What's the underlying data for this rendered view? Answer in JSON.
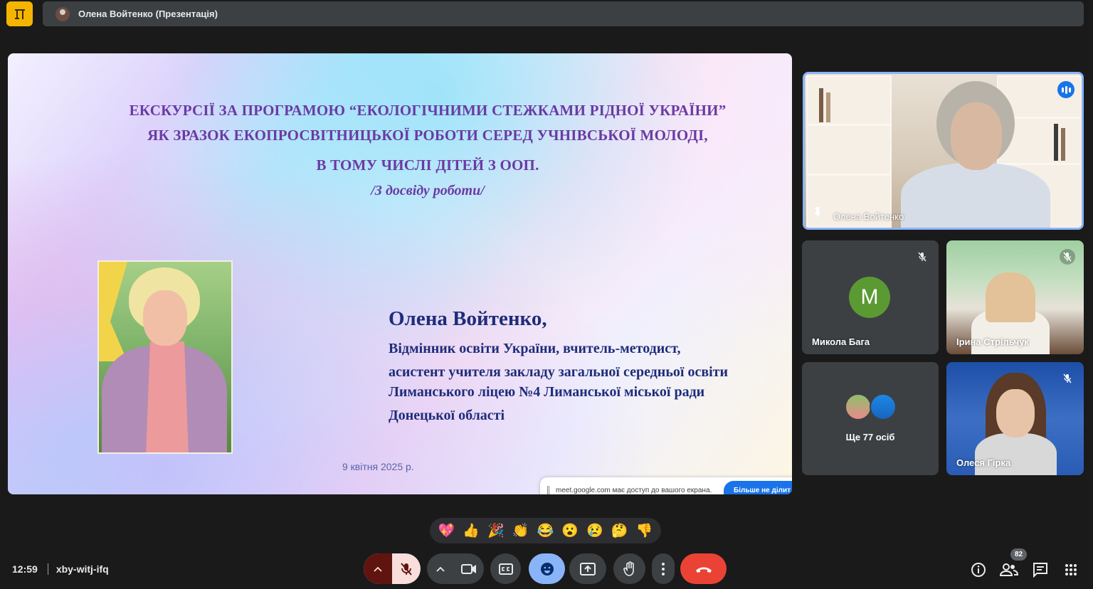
{
  "topbar": {
    "app_logo": "meet-logo",
    "presenting_title": "Олена Войтенко (Презентація)"
  },
  "slide": {
    "heading_lines": [
      "ЕКСКУРСІЇ ЗА ПРОГРАМОЮ “ЕКОЛОГІЧНИМИ СТЕЖКАМИ РІДНОЇ УКРАЇНИ”",
      "ЯК ЗРАЗОК ЕКОПРОСВІТНИЦЬКОЇ РОБОТИ СЕРЕД УЧНІВСЬКОЇ МОЛОДІ,",
      "В ТОМУ ЧИСЛІ ДІТЕЙ З ООП."
    ],
    "subtitle": "/З досвіду роботи/",
    "author_name": "Олена Войтенко,",
    "author_lines": [
      "Відмінник освіти України, вчитель-методист,",
      "асистент учителя закладу загальної середньої освіти",
      "Лиманського  ліцею №4  Лиманської  міської  ради",
      "Донецької області"
    ],
    "date": "9 квітня 2025 р."
  },
  "share_notice": {
    "text": "meet.google.com має доступ до вашого екрана.",
    "button": "Більше не ділит"
  },
  "participants": {
    "presenter": {
      "name": "Олена Войтенко"
    },
    "tiles": [
      {
        "name": "Микола Бага",
        "initial": "М",
        "avatar_color": "#5b9a32"
      },
      {
        "name": "Ірина Стрільчук"
      },
      {
        "name": "Ще 77 осіб"
      },
      {
        "name": "Олеся Гірка"
      }
    ]
  },
  "reactions": [
    "💖",
    "👍",
    "🎉",
    "👏",
    "😂",
    "😮",
    "😢",
    "🤔",
    "👎"
  ],
  "bottom": {
    "time": "12:59",
    "meeting_code": "xby-witj-ifq",
    "participant_count": "82"
  },
  "colors": {
    "accent": "#8ab4f8",
    "emoji_active": "#8ab4f8",
    "leave": "#ea4335",
    "mic_off_bg": "#f9dedc",
    "slide_heading": "#6b3aa3",
    "slide_text": "#1f2c7a"
  }
}
